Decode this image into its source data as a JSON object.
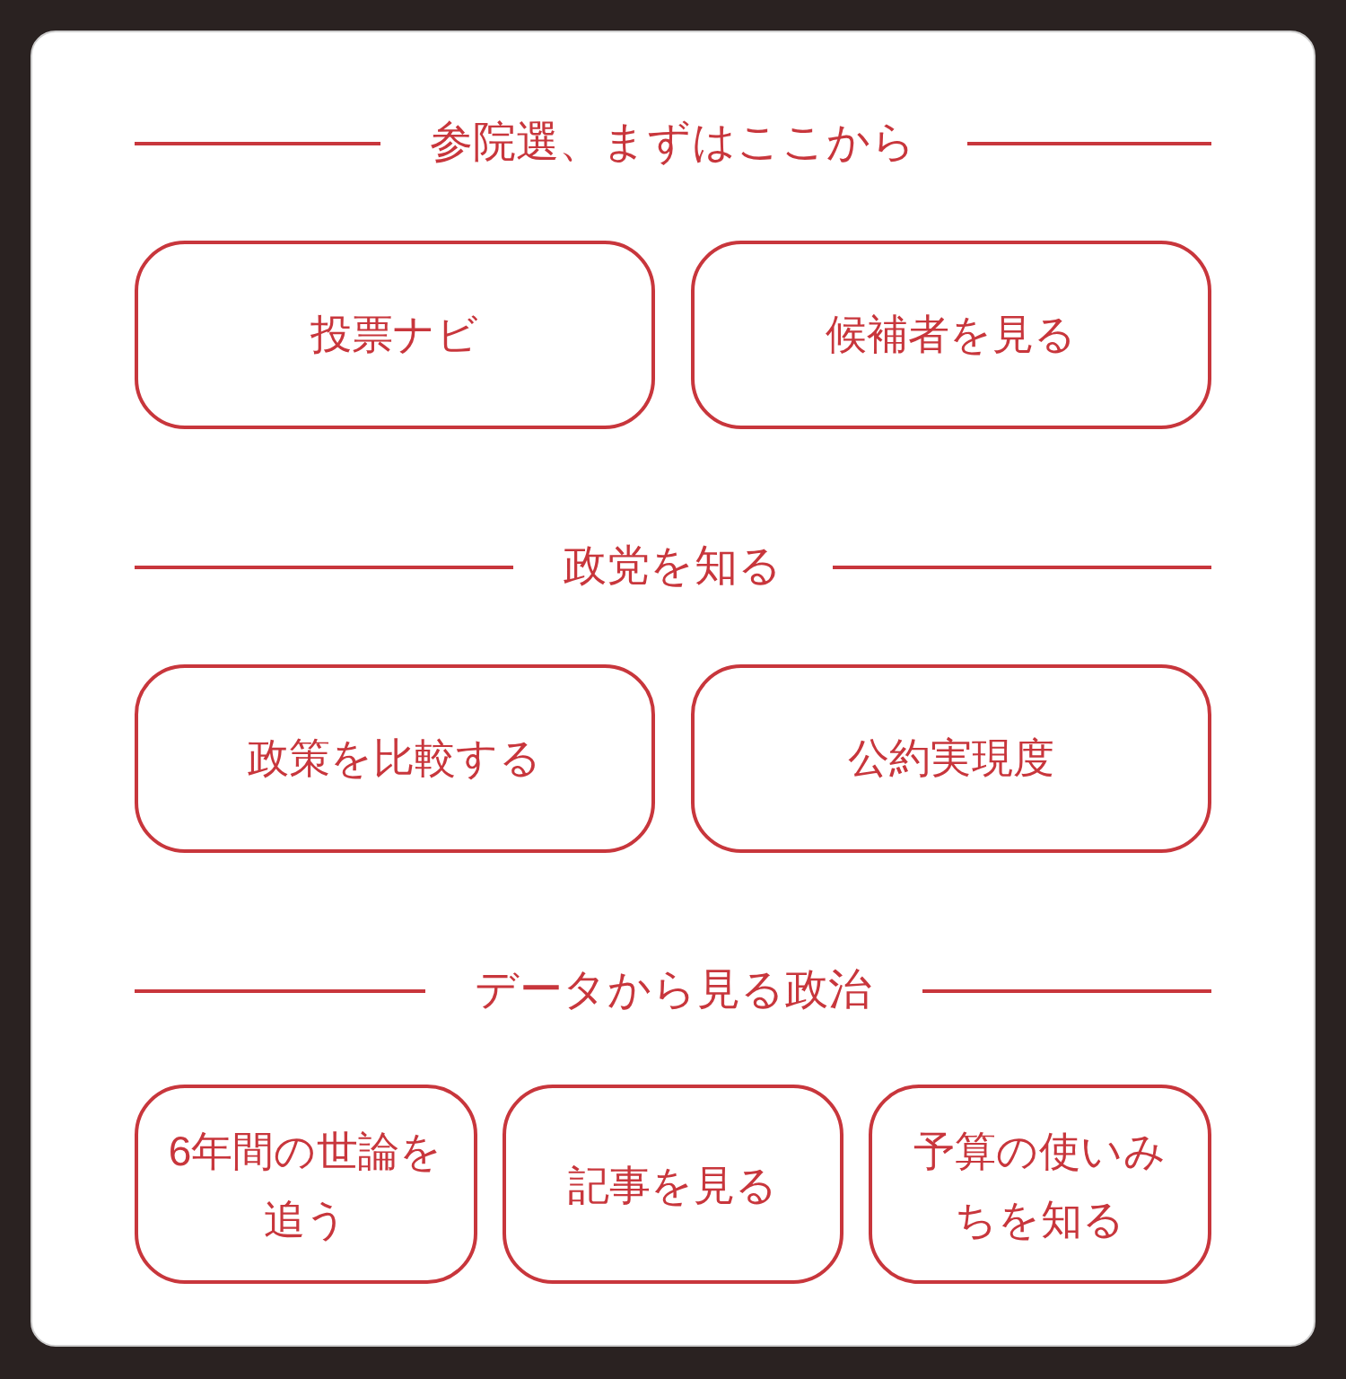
{
  "sections": [
    {
      "title": "参院選、まずはここから",
      "buttons": [
        "投票ナビ",
        "候補者を見る"
      ]
    },
    {
      "title": "政党を知る",
      "buttons": [
        "政策を比較する",
        "公約実現度"
      ]
    },
    {
      "title": "データから見る政治",
      "buttons": [
        "6年間の世論を追う",
        "記事を見る",
        "予算の使いみちを知る"
      ]
    }
  ]
}
